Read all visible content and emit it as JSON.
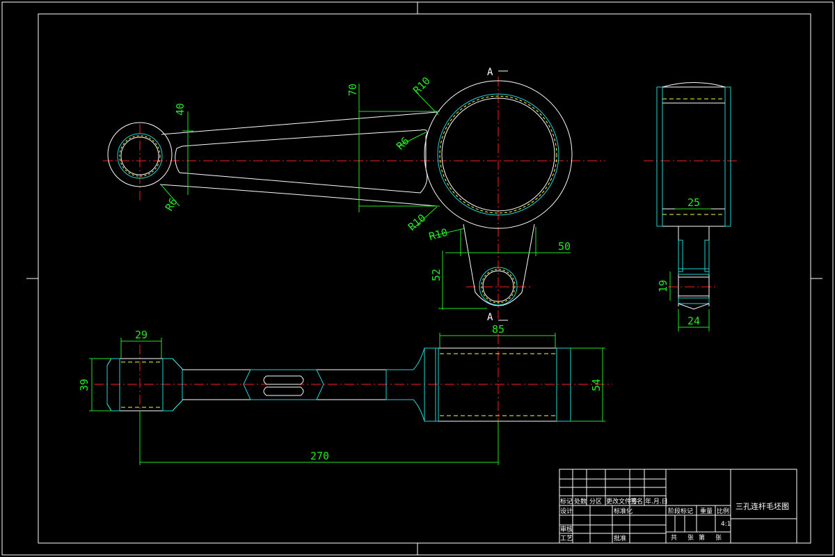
{
  "dimensions": {
    "d40": "40",
    "d70": "70",
    "r10_top": "R10",
    "r6_inner": "R6",
    "r6_small": "R6",
    "r10_lower": "R10",
    "r10_boss": "R10",
    "d50": "50",
    "d52": "52",
    "d25": "25",
    "d19": "19",
    "d24": "24",
    "d29": "29",
    "d39": "39",
    "d85": "85",
    "d54": "54",
    "d270": "270"
  },
  "section_marks": {
    "top": "A",
    "bottom": "A"
  },
  "title_block": {
    "drawing_title": "三孔连杆毛坯图",
    "row_labels": [
      "标记",
      "处数",
      "分区",
      "更改文件号",
      "签名",
      "年.月.日"
    ],
    "design": "设计",
    "standardization": "标准化",
    "review": "审核",
    "process": "工艺",
    "approval": "批准",
    "stage_mark": "阶段标记",
    "weight": "重量",
    "scale_label": "比例",
    "scale_value": "4:1",
    "sheets_total": "共",
    "sheets_label": "张",
    "sheet_no": "第",
    "sheet_label": "张"
  },
  "colors": {
    "outline": "#ffffff",
    "dimension": "#22e822",
    "centerline": "#ff2020",
    "hidden": "#ffff33",
    "hatch": "#22d6d6"
  }
}
